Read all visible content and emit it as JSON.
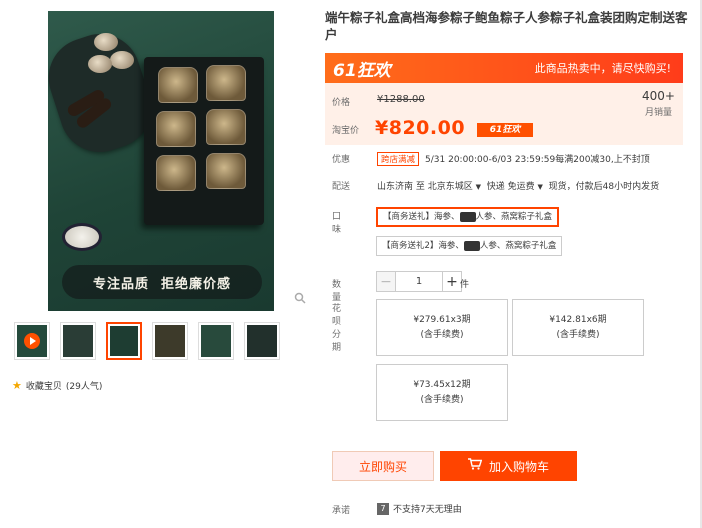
{
  "product": {
    "title": "端午粽子礼盒高档海参粽子鲍鱼粽子人参粽子礼盒装团购定制送客户",
    "image_slogan": [
      "专注品质",
      "拒绝廉价感"
    ],
    "favorite": {
      "label": "收藏宝贝",
      "count": "(29人气)"
    }
  },
  "promo": {
    "logo": "61狂欢",
    "text": "此商品热卖中，请尽快购买!"
  },
  "price": {
    "price_label": "价格",
    "old_price": "¥1288.00",
    "taobao_label": "淘宝价",
    "new_price": "¥820.00",
    "tag": "61狂欢",
    "sales_count": "400+",
    "sales_label": "月销量"
  },
  "coupon": {
    "label": "优惠",
    "badge": "跨店满减",
    "text": "5/31 20:00:00-6/03 23:59:59每满200减30,上不封顶"
  },
  "shipping": {
    "label": "配送",
    "from": "山东济南 至",
    "to": "北京东城区",
    "method": "快递 免运费",
    "note": "现货，付款后48小时内发货"
  },
  "flavor": {
    "label": "口味",
    "options": [
      {
        "prefix": "【商务送礼】海参、",
        "suffix": "人参、燕窝粽子礼盒",
        "selected": true
      },
      {
        "prefix": "【商务送礼2】海参、",
        "suffix": "人参、燕窝粽子礼盒",
        "selected": false
      }
    ]
  },
  "quantity": {
    "label": "数量",
    "value": "1",
    "unit": "件",
    "minus": "−",
    "plus": "+"
  },
  "installment": {
    "label": "花呗分期",
    "plans": [
      {
        "amount": "¥279.61x3期",
        "fee": "(含手续费)"
      },
      {
        "amount": "¥142.81x6期",
        "fee": "(含手续费)"
      },
      {
        "amount": "¥73.45x12期",
        "fee": "(含手续费)"
      }
    ]
  },
  "actions": {
    "buy_now": "立即购买",
    "add_cart": "加入购物车"
  },
  "promise": {
    "label": "承诺",
    "icon_text": "7",
    "text": "不支持7天无理由"
  },
  "icons": {
    "zoom": "search-icon",
    "star": "star-icon",
    "cart": "cart-icon",
    "play": "play-icon"
  }
}
